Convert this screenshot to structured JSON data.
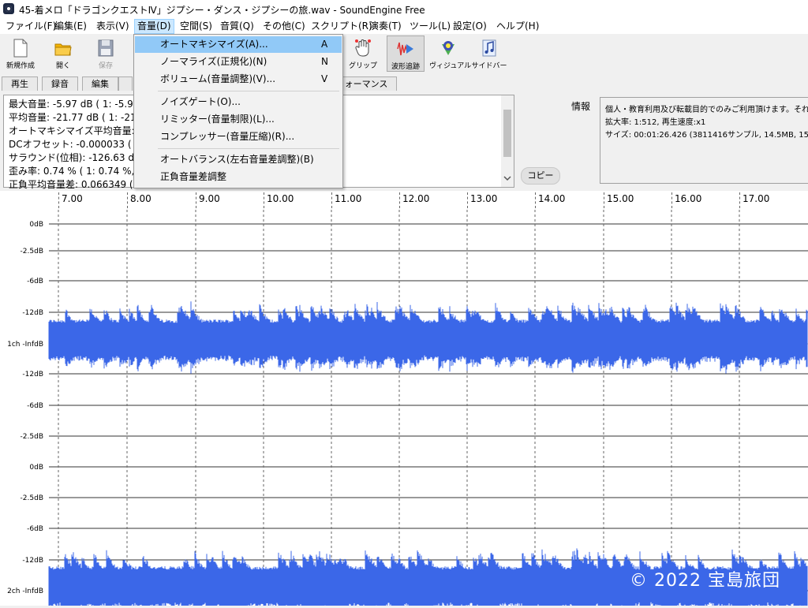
{
  "window": {
    "title": "45-着メロ「ドラゴンクエストⅣ」ジプシー・ダンス・ジプシーの旅.wav - SoundEngine Free"
  },
  "menubar": {
    "items": [
      {
        "label": "ファイル(F)"
      },
      {
        "label": "編集(E)"
      },
      {
        "label": "表示(V)"
      },
      {
        "label": "音量(D)"
      },
      {
        "label": "空間(S)"
      },
      {
        "label": "音質(Q)"
      },
      {
        "label": "その他(C)"
      },
      {
        "label": "スクリプト(R)"
      },
      {
        "label": "演奏(T)"
      },
      {
        "label": "ツール(L)"
      },
      {
        "label": "設定(O)"
      },
      {
        "label": "ヘルプ(H)"
      }
    ],
    "active": "音量(D)"
  },
  "toolbar": {
    "new_label": "新規作成",
    "open_label": "開く",
    "save_label": "保存",
    "grip_label": "グリップ",
    "follow_label": "波形追跡",
    "visual_label": "ヴィジュアル",
    "sidebar_label": "サイドバー"
  },
  "tabs": {
    "play": "再生",
    "record": "録音",
    "edit": "編集",
    "performance": "ォーマンス"
  },
  "stats": {
    "lines": [
      "最大音量: -5.97 dB ( 1: -5.97",
      "平均音量: -21.77 dB ( 1: -21",
      "オートマキシマイズ平均音量: -2",
      "DCオフセット: -0.000033 ( 1: -",
      "サラウンド(位相): -126.63 dB",
      "歪み率: 0.74 % ( 1: 0.74 %,",
      "正負平均音量差: 0.066349 ("
    ]
  },
  "info": {
    "label": "情報",
    "lines": [
      "個人・教育利用及び転載目的でのみご利用頂けます。それ",
      "拡大率: 1:512, 再生速度:x1",
      "サイズ: 00:01:26.426 (3811416サンプル, 14.5MB, 152457"
    ],
    "copy_label": "コピー"
  },
  "volume_menu": {
    "items": [
      {
        "label": "オートマキシマイズ(A)...",
        "key": "A"
      },
      {
        "label": "ノーマライズ(正規化)(N)",
        "key": "N"
      },
      {
        "label": "ボリューム(音量調整)(V)...",
        "key": "V"
      },
      {
        "label": "ノイズゲート(O)...",
        "key": ""
      },
      {
        "label": "リミッター(音量制限)(L)...",
        "key": ""
      },
      {
        "label": "コンプレッサー(音量圧縮)(R)...",
        "key": ""
      },
      {
        "label": "オートバランス(左右音量差調整)(B)",
        "key": ""
      },
      {
        "label": "正負音量差調整",
        "key": ""
      }
    ],
    "highlighted": "オートマキシマイズ(A)..."
  },
  "ruler": {
    "labels": [
      "7.00",
      "8.00",
      "9.00",
      "10.00",
      "11.00",
      "12.00",
      "13.00",
      "14.00",
      "15.00",
      "16.00",
      "17.00"
    ]
  },
  "waveform": {
    "ch1_labels": [
      "0dB",
      "-2.5dB",
      "-6dB",
      "-12dB",
      "1ch -InfdB",
      "-12dB",
      "-6dB",
      "-2.5dB"
    ],
    "ch2_labels": [
      "0dB",
      "-2.5dB",
      "-6dB",
      "-12dB",
      "2ch -InfdB"
    ],
    "wave_color": "#3b67e8"
  },
  "watermark": "© 2022 宝島旅団"
}
